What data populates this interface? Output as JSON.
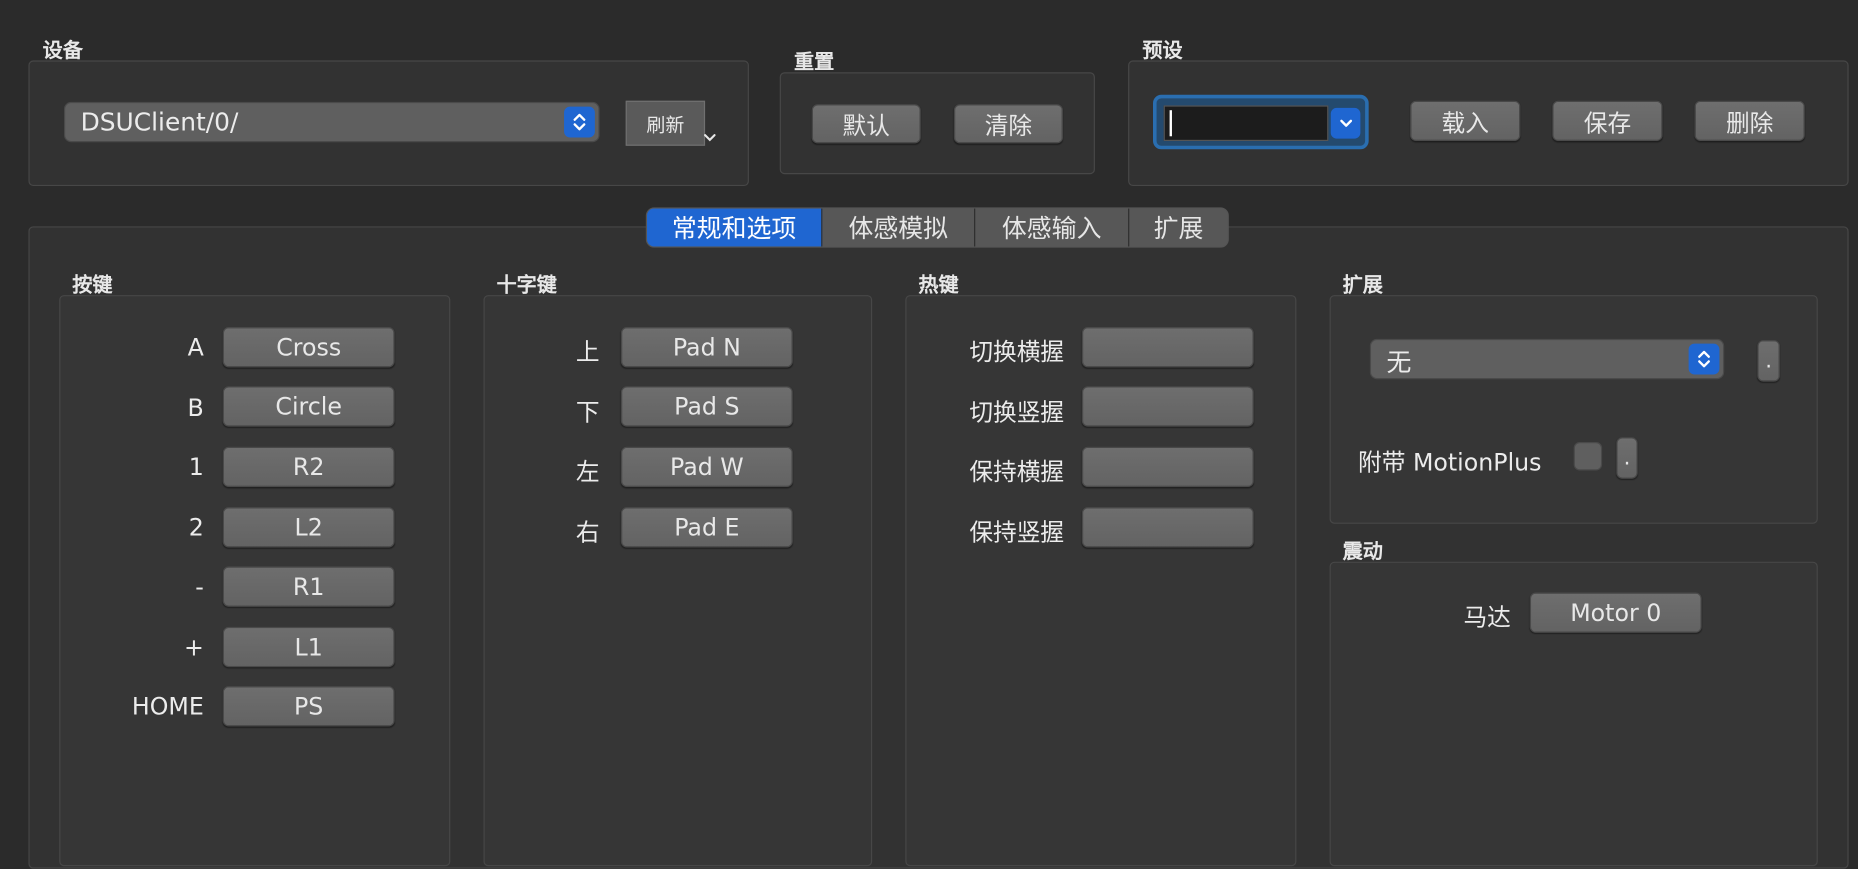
{
  "device": {
    "group_title": "设备",
    "selected": "DSUClient/0/",
    "refresh_label": "刷新"
  },
  "reset": {
    "group_title": "重置",
    "default_label": "默认",
    "clear_label": "清除"
  },
  "preset": {
    "group_title": "预设",
    "input_value": "",
    "load_label": "载入",
    "save_label": "保存",
    "delete_label": "删除"
  },
  "tabs": [
    {
      "label": "常规和选项",
      "active": true
    },
    {
      "label": "体感模拟",
      "active": false
    },
    {
      "label": "体感输入",
      "active": false
    },
    {
      "label": "扩展",
      "active": false
    }
  ],
  "buttons_section": {
    "title": "按键",
    "rows": [
      {
        "label": "A",
        "value": "Cross"
      },
      {
        "label": "B",
        "value": "Circle"
      },
      {
        "label": "1",
        "value": "R2"
      },
      {
        "label": "2",
        "value": "L2"
      },
      {
        "label": "-",
        "value": "R1"
      },
      {
        "label": "+",
        "value": "L1"
      },
      {
        "label": "HOME",
        "value": "PS"
      }
    ]
  },
  "dpad_section": {
    "title": "十字键",
    "rows": [
      {
        "label": "上",
        "value": "Pad N"
      },
      {
        "label": "下",
        "value": "Pad S"
      },
      {
        "label": "左",
        "value": "Pad W"
      },
      {
        "label": "右",
        "value": "Pad E"
      }
    ]
  },
  "hotkeys_section": {
    "title": "热键",
    "rows": [
      {
        "label": "切换横握",
        "value": ""
      },
      {
        "label": "切换竖握",
        "value": ""
      },
      {
        "label": "保持横握",
        "value": ""
      },
      {
        "label": "保持竖握",
        "value": ""
      }
    ]
  },
  "extension_section": {
    "title": "扩展",
    "selected": "无",
    "more_label": ".",
    "motionplus_label": "附带 MotionPlus",
    "motionplus_checked": false,
    "motionplus_more_label": "."
  },
  "rumble_section": {
    "title": "震动",
    "motor_label": "马达",
    "motor_value": "Motor 0"
  },
  "colors": {
    "accent": "#1f66d1",
    "focus_ring": "#2a6eb0",
    "background": "#2b2b2b"
  }
}
